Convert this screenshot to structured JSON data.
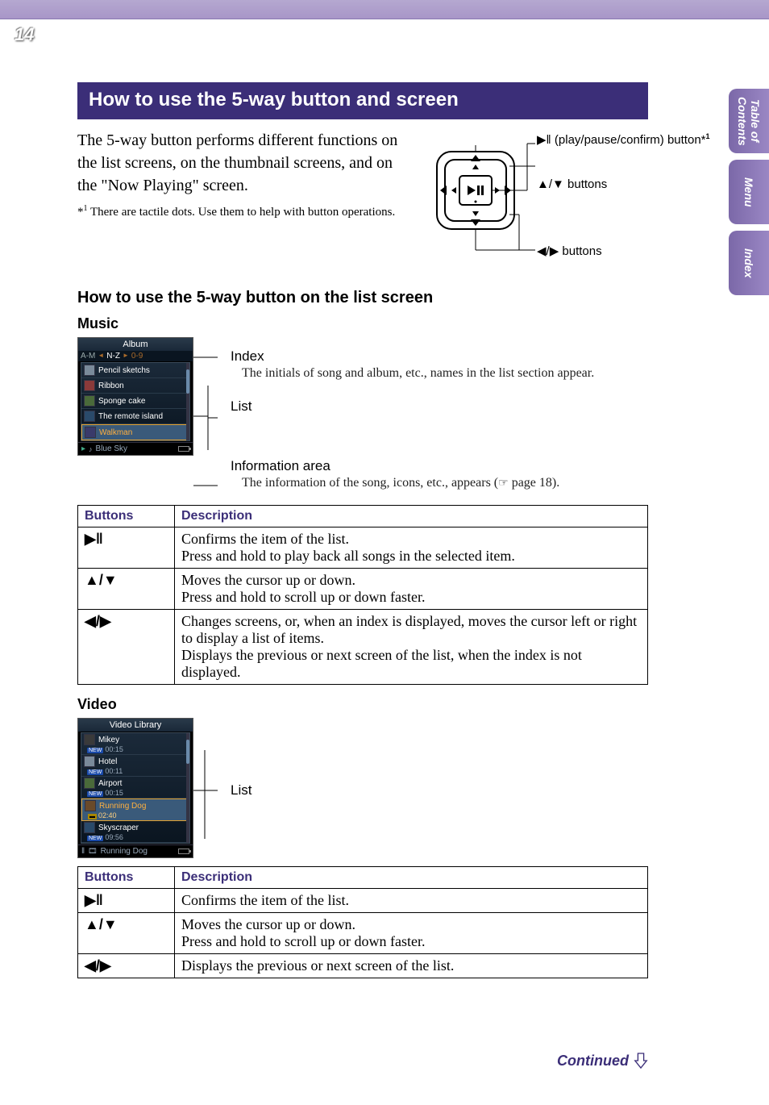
{
  "page_number": "14",
  "side_tabs": [
    "Table of\nContents",
    "Menu",
    "Index"
  ],
  "header": "How to use the 5-way button and screen",
  "intro": "The 5-way button performs different functions on the list screens, on the thumbnail screens, and on the \"Now Playing\" screen.",
  "footnote_marker": "*1",
  "footnote_text": "There are tactile dots. Use them to help with button operations.",
  "diagram": {
    "play_pause": " (play/pause/confirm) button*",
    "play_pause_sup": "1",
    "updown": " buttons",
    "leftright": " buttons"
  },
  "subheader": "How to use the 5-way button on the list screen",
  "music_heading": "Music",
  "music_screen": {
    "title": "Album",
    "tabs_left": "A-M",
    "tabs_mid": "N-Z",
    "tabs_right": "0-9",
    "items": [
      "Pencil sketchs",
      "Ribbon",
      "Sponge cake",
      "The remote island",
      "Walkman"
    ],
    "selected_index": 4,
    "footer_icon": "♪",
    "footer_text": "Blue Sky"
  },
  "music_callouts": {
    "index_label": "Index",
    "index_desc": "The initials of song and album, etc., names in the list section appear.",
    "list_label": "List",
    "info_label": "Information area",
    "info_desc_prefix": "The information of the song, icons, etc., appears (",
    "info_desc_page": " page 18).",
    "hand_icon": "☞"
  },
  "table_headers": {
    "buttons": "Buttons",
    "description": "Description"
  },
  "music_table": [
    {
      "icon": "play-pause",
      "desc": "Confirms the item of the list.\nPress and hold to play back all songs in the selected item."
    },
    {
      "icon": "up-down",
      "desc": "Moves the cursor up or down.\nPress and hold to scroll up or down faster."
    },
    {
      "icon": "left-right",
      "desc": "Changes screens, or, when an index is displayed, moves the cursor left or right to display a list of items.\nDisplays the previous or next screen of the list, when the index is not displayed."
    }
  ],
  "video_heading": "Video",
  "video_screen": {
    "title": "Video Library",
    "items": [
      {
        "name": "Mikey",
        "time": "00:15",
        "new": true
      },
      {
        "name": "Hotel",
        "time": "00:11",
        "new": true
      },
      {
        "name": "Airport",
        "time": "00:15",
        "new": true
      },
      {
        "name": "Running Dog",
        "time": "02:40",
        "new": false
      },
      {
        "name": "Skyscraper",
        "time": "09:56",
        "new": true
      }
    ],
    "selected_index": 3,
    "footer_text": "Running Dog"
  },
  "video_callouts": {
    "list_label": "List"
  },
  "video_table": [
    {
      "icon": "play-pause",
      "desc": "Confirms the item of the list."
    },
    {
      "icon": "up-down",
      "desc": "Moves the cursor up or down.\nPress and hold to scroll up or down faster."
    },
    {
      "icon": "left-right",
      "desc": "Displays the previous or next screen of the list."
    }
  ],
  "continued": "Continued",
  "icons": {
    "play-pause": "▶ǁ",
    "up-down": "▲/▼",
    "left-right": "◀/▶",
    "play": "▶",
    "up": "▲",
    "down": "▼",
    "left": "◀",
    "right": "▶"
  }
}
